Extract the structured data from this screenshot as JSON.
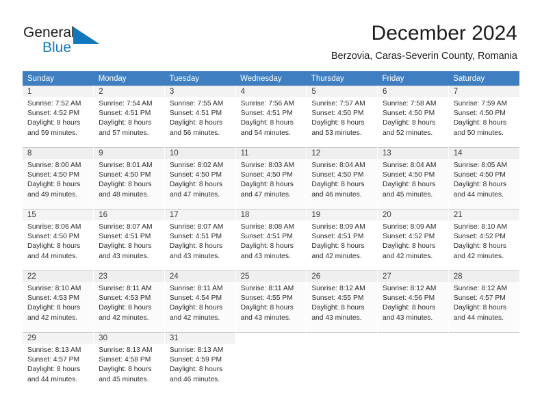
{
  "brand": {
    "name_part1": "General",
    "name_part2": "Blue",
    "triangle_color": "#1278be",
    "accent_color": "#1278be"
  },
  "header": {
    "month_title": "December 2024",
    "location": "Berzovia, Caras-Severin County, Romania"
  },
  "calendar": {
    "header_bg": "#3f7fc1",
    "weekday_headers": [
      "Sunday",
      "Monday",
      "Tuesday",
      "Wednesday",
      "Thursday",
      "Friday",
      "Saturday"
    ],
    "weeks": [
      {
        "shaded": false,
        "days": [
          {
            "day": "1",
            "sunrise": "Sunrise: 7:52 AM",
            "sunset": "Sunset: 4:52 PM",
            "daylight_line1": "Daylight: 8 hours",
            "daylight_line2": "and 59 minutes."
          },
          {
            "day": "2",
            "sunrise": "Sunrise: 7:54 AM",
            "sunset": "Sunset: 4:51 PM",
            "daylight_line1": "Daylight: 8 hours",
            "daylight_line2": "and 57 minutes."
          },
          {
            "day": "3",
            "sunrise": "Sunrise: 7:55 AM",
            "sunset": "Sunset: 4:51 PM",
            "daylight_line1": "Daylight: 8 hours",
            "daylight_line2": "and 56 minutes."
          },
          {
            "day": "4",
            "sunrise": "Sunrise: 7:56 AM",
            "sunset": "Sunset: 4:51 PM",
            "daylight_line1": "Daylight: 8 hours",
            "daylight_line2": "and 54 minutes."
          },
          {
            "day": "5",
            "sunrise": "Sunrise: 7:57 AM",
            "sunset": "Sunset: 4:50 PM",
            "daylight_line1": "Daylight: 8 hours",
            "daylight_line2": "and 53 minutes."
          },
          {
            "day": "6",
            "sunrise": "Sunrise: 7:58 AM",
            "sunset": "Sunset: 4:50 PM",
            "daylight_line1": "Daylight: 8 hours",
            "daylight_line2": "and 52 minutes."
          },
          {
            "day": "7",
            "sunrise": "Sunrise: 7:59 AM",
            "sunset": "Sunset: 4:50 PM",
            "daylight_line1": "Daylight: 8 hours",
            "daylight_line2": "and 50 minutes."
          }
        ]
      },
      {
        "shaded": true,
        "days": [
          {
            "day": "8",
            "sunrise": "Sunrise: 8:00 AM",
            "sunset": "Sunset: 4:50 PM",
            "daylight_line1": "Daylight: 8 hours",
            "daylight_line2": "and 49 minutes."
          },
          {
            "day": "9",
            "sunrise": "Sunrise: 8:01 AM",
            "sunset": "Sunset: 4:50 PM",
            "daylight_line1": "Daylight: 8 hours",
            "daylight_line2": "and 48 minutes."
          },
          {
            "day": "10",
            "sunrise": "Sunrise: 8:02 AM",
            "sunset": "Sunset: 4:50 PM",
            "daylight_line1": "Daylight: 8 hours",
            "daylight_line2": "and 47 minutes."
          },
          {
            "day": "11",
            "sunrise": "Sunrise: 8:03 AM",
            "sunset": "Sunset: 4:50 PM",
            "daylight_line1": "Daylight: 8 hours",
            "daylight_line2": "and 47 minutes."
          },
          {
            "day": "12",
            "sunrise": "Sunrise: 8:04 AM",
            "sunset": "Sunset: 4:50 PM",
            "daylight_line1": "Daylight: 8 hours",
            "daylight_line2": "and 46 minutes."
          },
          {
            "day": "13",
            "sunrise": "Sunrise: 8:04 AM",
            "sunset": "Sunset: 4:50 PM",
            "daylight_line1": "Daylight: 8 hours",
            "daylight_line2": "and 45 minutes."
          },
          {
            "day": "14",
            "sunrise": "Sunrise: 8:05 AM",
            "sunset": "Sunset: 4:50 PM",
            "daylight_line1": "Daylight: 8 hours",
            "daylight_line2": "and 44 minutes."
          }
        ]
      },
      {
        "shaded": false,
        "days": [
          {
            "day": "15",
            "sunrise": "Sunrise: 8:06 AM",
            "sunset": "Sunset: 4:50 PM",
            "daylight_line1": "Daylight: 8 hours",
            "daylight_line2": "and 44 minutes."
          },
          {
            "day": "16",
            "sunrise": "Sunrise: 8:07 AM",
            "sunset": "Sunset: 4:51 PM",
            "daylight_line1": "Daylight: 8 hours",
            "daylight_line2": "and 43 minutes."
          },
          {
            "day": "17",
            "sunrise": "Sunrise: 8:07 AM",
            "sunset": "Sunset: 4:51 PM",
            "daylight_line1": "Daylight: 8 hours",
            "daylight_line2": "and 43 minutes."
          },
          {
            "day": "18",
            "sunrise": "Sunrise: 8:08 AM",
            "sunset": "Sunset: 4:51 PM",
            "daylight_line1": "Daylight: 8 hours",
            "daylight_line2": "and 43 minutes."
          },
          {
            "day": "19",
            "sunrise": "Sunrise: 8:09 AM",
            "sunset": "Sunset: 4:51 PM",
            "daylight_line1": "Daylight: 8 hours",
            "daylight_line2": "and 42 minutes."
          },
          {
            "day": "20",
            "sunrise": "Sunrise: 8:09 AM",
            "sunset": "Sunset: 4:52 PM",
            "daylight_line1": "Daylight: 8 hours",
            "daylight_line2": "and 42 minutes."
          },
          {
            "day": "21",
            "sunrise": "Sunrise: 8:10 AM",
            "sunset": "Sunset: 4:52 PM",
            "daylight_line1": "Daylight: 8 hours",
            "daylight_line2": "and 42 minutes."
          }
        ]
      },
      {
        "shaded": true,
        "days": [
          {
            "day": "22",
            "sunrise": "Sunrise: 8:10 AM",
            "sunset": "Sunset: 4:53 PM",
            "daylight_line1": "Daylight: 8 hours",
            "daylight_line2": "and 42 minutes."
          },
          {
            "day": "23",
            "sunrise": "Sunrise: 8:11 AM",
            "sunset": "Sunset: 4:53 PM",
            "daylight_line1": "Daylight: 8 hours",
            "daylight_line2": "and 42 minutes."
          },
          {
            "day": "24",
            "sunrise": "Sunrise: 8:11 AM",
            "sunset": "Sunset: 4:54 PM",
            "daylight_line1": "Daylight: 8 hours",
            "daylight_line2": "and 42 minutes."
          },
          {
            "day": "25",
            "sunrise": "Sunrise: 8:11 AM",
            "sunset": "Sunset: 4:55 PM",
            "daylight_line1": "Daylight: 8 hours",
            "daylight_line2": "and 43 minutes."
          },
          {
            "day": "26",
            "sunrise": "Sunrise: 8:12 AM",
            "sunset": "Sunset: 4:55 PM",
            "daylight_line1": "Daylight: 8 hours",
            "daylight_line2": "and 43 minutes."
          },
          {
            "day": "27",
            "sunrise": "Sunrise: 8:12 AM",
            "sunset": "Sunset: 4:56 PM",
            "daylight_line1": "Daylight: 8 hours",
            "daylight_line2": "and 43 minutes."
          },
          {
            "day": "28",
            "sunrise": "Sunrise: 8:12 AM",
            "sunset": "Sunset: 4:57 PM",
            "daylight_line1": "Daylight: 8 hours",
            "daylight_line2": "and 44 minutes."
          }
        ]
      },
      {
        "shaded": false,
        "days": [
          {
            "day": "29",
            "sunrise": "Sunrise: 8:13 AM",
            "sunset": "Sunset: 4:57 PM",
            "daylight_line1": "Daylight: 8 hours",
            "daylight_line2": "and 44 minutes."
          },
          {
            "day": "30",
            "sunrise": "Sunrise: 8:13 AM",
            "sunset": "Sunset: 4:58 PM",
            "daylight_line1": "Daylight: 8 hours",
            "daylight_line2": "and 45 minutes."
          },
          {
            "day": "31",
            "sunrise": "Sunrise: 8:13 AM",
            "sunset": "Sunset: 4:59 PM",
            "daylight_line1": "Daylight: 8 hours",
            "daylight_line2": "and 46 minutes."
          },
          {
            "day": "",
            "sunrise": "",
            "sunset": "",
            "daylight_line1": "",
            "daylight_line2": ""
          },
          {
            "day": "",
            "sunrise": "",
            "sunset": "",
            "daylight_line1": "",
            "daylight_line2": ""
          },
          {
            "day": "",
            "sunrise": "",
            "sunset": "",
            "daylight_line1": "",
            "daylight_line2": ""
          },
          {
            "day": "",
            "sunrise": "",
            "sunset": "",
            "daylight_line1": "",
            "daylight_line2": ""
          }
        ]
      }
    ]
  }
}
